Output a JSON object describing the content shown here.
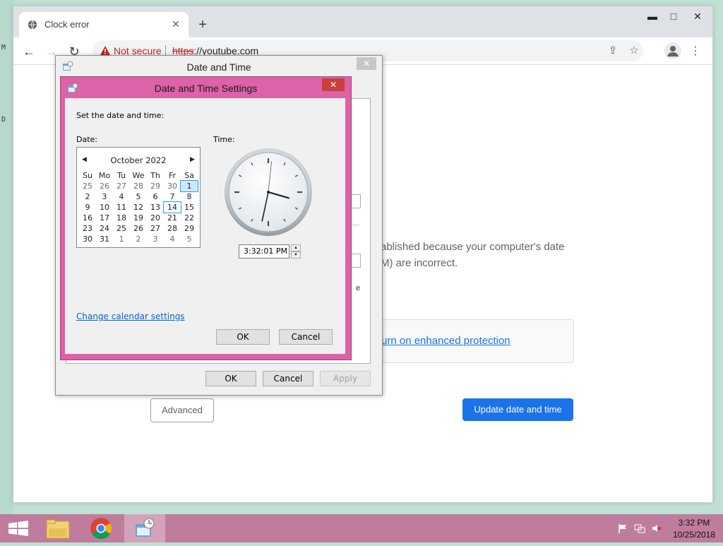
{
  "browser": {
    "tab_title": "Clock error",
    "omnibox": {
      "security_label": "Not secure",
      "url_scheme": "https",
      "url_rest": "://youtube.com"
    }
  },
  "page": {
    "body_line1": "ablished because your computer's date",
    "body_line2": "M) are incorrect.",
    "enhanced_link": "urn on enhanced protection",
    "advanced_button": "Advanced",
    "update_button": "Update date and time"
  },
  "date_time_dialog": {
    "title": "Date and Time",
    "ok": "OK",
    "cancel": "Cancel",
    "apply": "Apply",
    "partial_text": "e"
  },
  "settings_dialog": {
    "title": "Date and Time Settings",
    "instruction": "Set the date and time:",
    "date_label": "Date:",
    "time_label": "Time:",
    "time_value": "3:32:01 PM",
    "change_calendar_link": "Change calendar settings",
    "ok": "OK",
    "cancel": "Cancel",
    "calendar": {
      "month_year": "October 2022",
      "weekdays": [
        "Su",
        "Mo",
        "Tu",
        "We",
        "Th",
        "Fr",
        "Sa"
      ],
      "weeks": [
        [
          {
            "d": "25",
            "dim": true
          },
          {
            "d": "26",
            "dim": true
          },
          {
            "d": "27",
            "dim": true
          },
          {
            "d": "28",
            "dim": true
          },
          {
            "d": "29",
            "dim": true
          },
          {
            "d": "30",
            "dim": true
          },
          {
            "d": "1",
            "sel": true
          }
        ],
        [
          {
            "d": "2"
          },
          {
            "d": "3"
          },
          {
            "d": "4"
          },
          {
            "d": "5"
          },
          {
            "d": "6"
          },
          {
            "d": "7"
          },
          {
            "d": "8"
          }
        ],
        [
          {
            "d": "9"
          },
          {
            "d": "10"
          },
          {
            "d": "11"
          },
          {
            "d": "12"
          },
          {
            "d": "13"
          },
          {
            "d": "14",
            "today": true
          },
          {
            "d": "15"
          }
        ],
        [
          {
            "d": "16"
          },
          {
            "d": "17"
          },
          {
            "d": "18"
          },
          {
            "d": "19"
          },
          {
            "d": "20"
          },
          {
            "d": "21"
          },
          {
            "d": "22"
          }
        ],
        [
          {
            "d": "23"
          },
          {
            "d": "24"
          },
          {
            "d": "25"
          },
          {
            "d": "26"
          },
          {
            "d": "27"
          },
          {
            "d": "28"
          },
          {
            "d": "29"
          }
        ],
        [
          {
            "d": "30"
          },
          {
            "d": "31"
          },
          {
            "d": "1",
            "dim": true
          },
          {
            "d": "2",
            "dim": true
          },
          {
            "d": "3",
            "dim": true
          },
          {
            "d": "4",
            "dim": true
          },
          {
            "d": "5",
            "dim": true
          }
        ]
      ]
    }
  },
  "taskbar": {
    "clock_time": "3:32 PM",
    "clock_date": "10/25/2018"
  },
  "colors": {
    "settings_frame": "#dd62a8",
    "taskbar": "#c07c9c",
    "chrome_blue": "#1a73e8",
    "not_secure_red": "#c5221f"
  }
}
